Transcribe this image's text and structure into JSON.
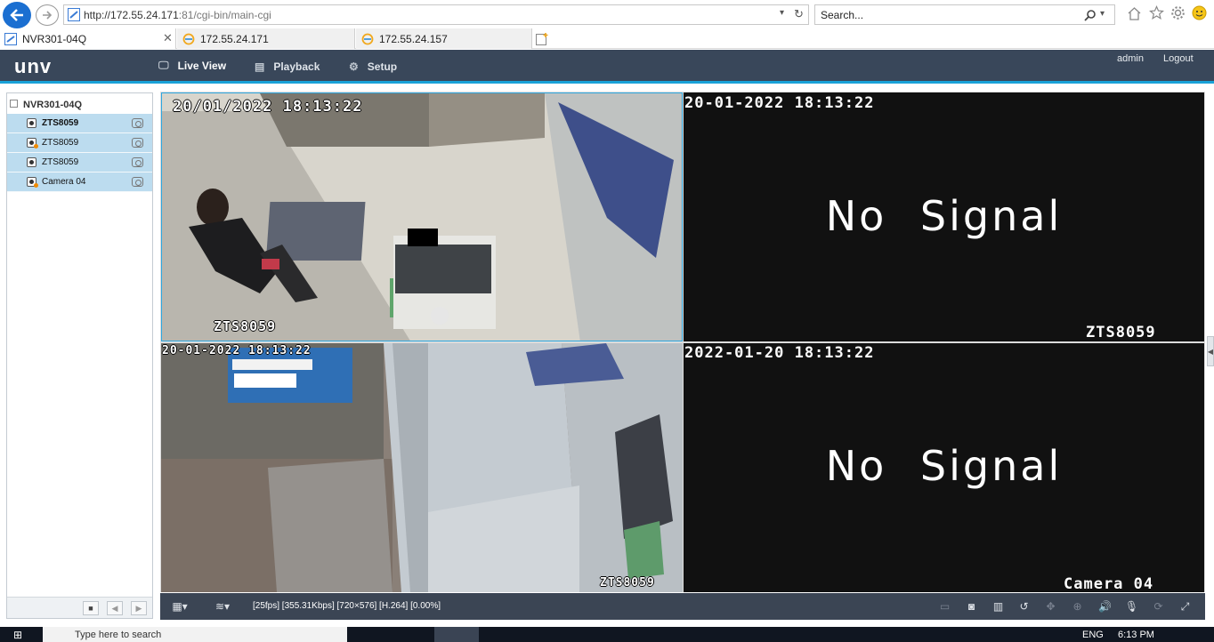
{
  "browser": {
    "url_host": "http://172.55.24.171",
    "url_rest": ":81/cgi-bin/main-cgi",
    "search_placeholder": "Search...",
    "tabs": [
      {
        "label": "NVR301-04Q",
        "active": true
      },
      {
        "label": "172.55.24.171",
        "active": false
      },
      {
        "label": "172.55.24.157",
        "active": false
      }
    ]
  },
  "app": {
    "logo": "unv",
    "nav": [
      {
        "label": "Live View",
        "icon": "monitor-icon",
        "active": true
      },
      {
        "label": "Playback",
        "icon": "film-icon",
        "active": false
      },
      {
        "label": "Setup",
        "icon": "gear-icon",
        "active": false
      }
    ],
    "user": "admin",
    "logout": "Logout",
    "accent": "#1aa2d8",
    "header_bg": "#39475a"
  },
  "sidebar": {
    "root": "NVR301-04Q",
    "channels": [
      {
        "label": "ZTS8059",
        "bold": true,
        "warning": false
      },
      {
        "label": "ZTS8059",
        "bold": false,
        "warning": true
      },
      {
        "label": "ZTS8059",
        "bold": false,
        "warning": false
      },
      {
        "label": "Camera 04",
        "bold": false,
        "warning": true
      }
    ]
  },
  "video": {
    "tiles": [
      {
        "timestamp": "20/01/2022 18:13:22",
        "channel": "ZTS8059",
        "signal": true
      },
      {
        "timestamp": "20-01-2022 18:13:22",
        "channel": "ZTS8059",
        "signal": false,
        "message": "No Signal"
      },
      {
        "timestamp": "20-01-2022 18:13:22",
        "channel": "ZTS8059",
        "signal": true
      },
      {
        "timestamp": "2022-01-20 18:13:22",
        "channel": "Camera 04",
        "signal": false,
        "message": "No Signal"
      }
    ],
    "stats": "[25fps] [355.31Kbps] [720×576] [H.264] [0.00%]"
  },
  "taskbar": {
    "search_placeholder": "Type here to search",
    "lang": "ENG",
    "time": "6:13 PM"
  }
}
